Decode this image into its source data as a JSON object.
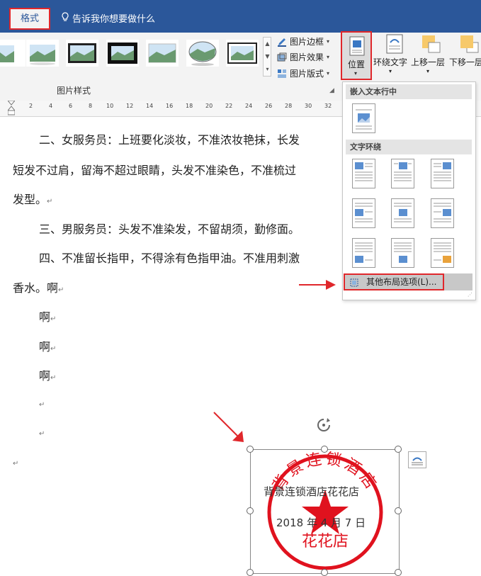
{
  "tabs": {
    "format_label": "格式",
    "tell_me": "告诉我你想要做什么"
  },
  "ribbon": {
    "group_label": "图片样式",
    "picture_border": "图片边框",
    "picture_effects": "图片效果",
    "picture_layout": "图片版式",
    "position": "位置",
    "wrap_text": "环绕文字",
    "bring_forward": "上移一层",
    "send_backward": "下移一层"
  },
  "ruler": {
    "ticks": [
      "2",
      "4",
      "6",
      "8",
      "10",
      "12",
      "14",
      "16",
      "18",
      "20",
      "22",
      "24",
      "26",
      "28",
      "30",
      "32"
    ]
  },
  "document": {
    "line1": "二、女服务员：上班要化淡妆，不准浓妆艳抹，长发",
    "line2": "短发不过肩，留海不超过眼睛，头发不准染色，不准梳过",
    "line3": "发型。",
    "line4": "三、男服务员：头发不准染发，不留胡须，勤修面。",
    "line5": "四、不准留长指甲，不得涂有色指甲油。不准用刺激",
    "line6": "香水。啊",
    "line7": "啊",
    "line8": "啊",
    "line9": "啊",
    "para_mark": "↵"
  },
  "dropdown": {
    "inline_header": "嵌入文本行中",
    "wrap_header": "文字环绕",
    "more_options": "其他布局选项(L)..."
  },
  "image": {
    "caption1": "背景连锁酒店花花店",
    "caption2": "2018 年 4 月 7 日",
    "seal_top_text": "背景连锁酒店",
    "seal_bottom_text": "花花店"
  },
  "colors": {
    "accent": "#2b579a",
    "highlight": "#e0272b",
    "seal": "#e0121e"
  }
}
